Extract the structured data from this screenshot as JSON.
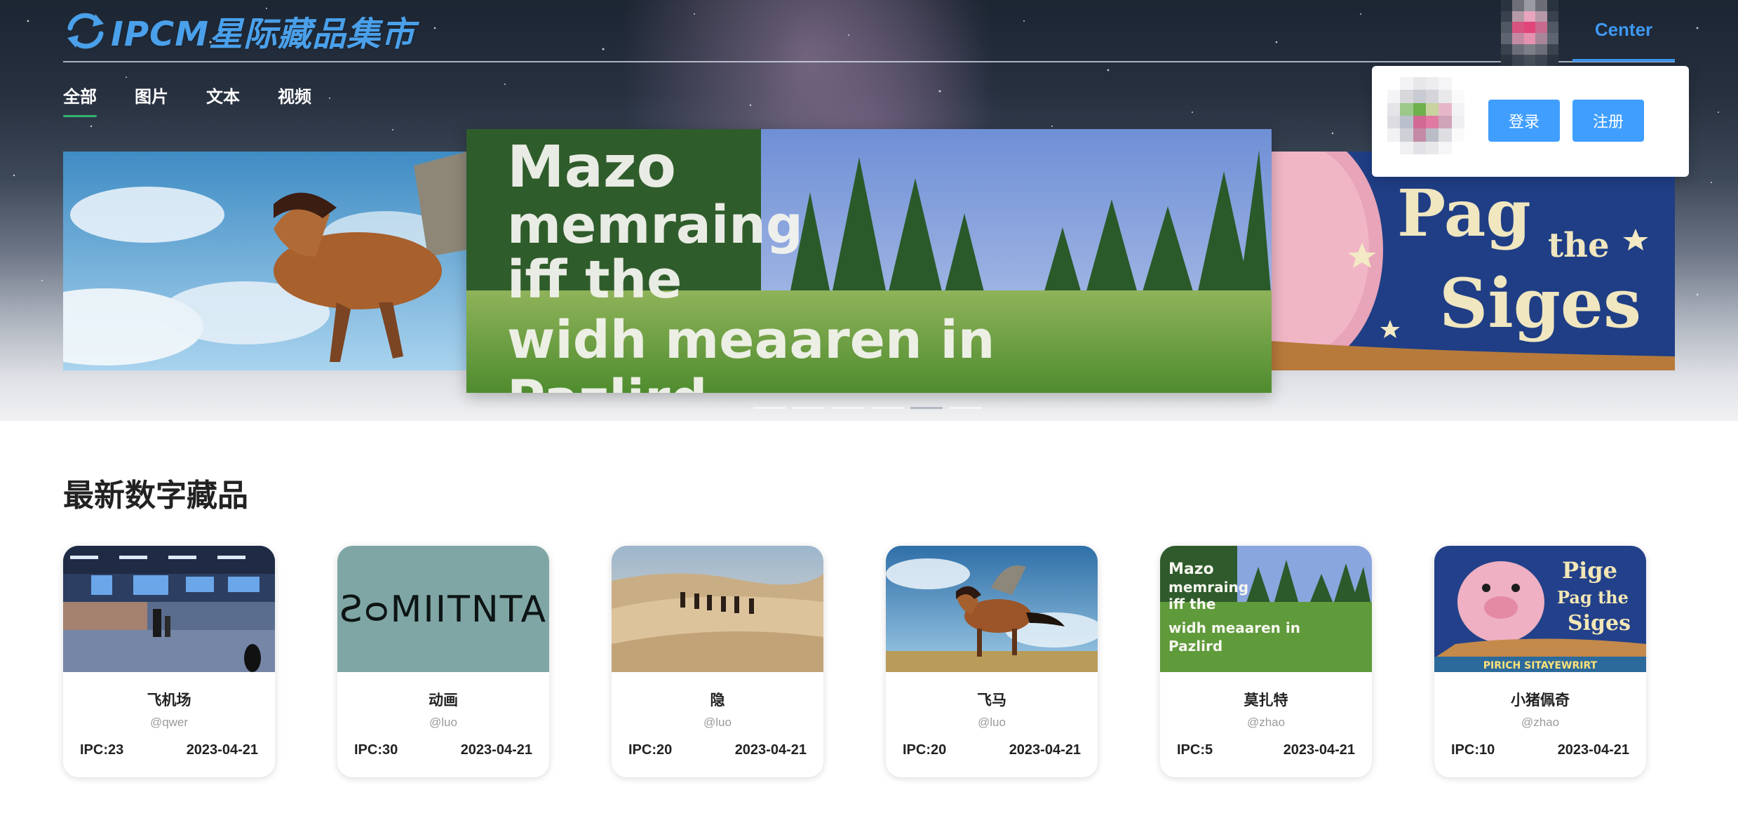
{
  "app": {
    "logo_text": "IPCM星际藏品集市",
    "center_label": "Center"
  },
  "tabs": [
    {
      "label": "全部",
      "active": true
    },
    {
      "label": "图片",
      "active": false
    },
    {
      "label": "文本",
      "active": false
    },
    {
      "label": "视频",
      "active": false
    }
  ],
  "carousel": {
    "slide_count": 6,
    "active_index": 4,
    "center_slide_text": [
      "Mazo",
      "memraing",
      "iff the",
      "widh meaaren in",
      "Pazlird"
    ],
    "right_slide_text": [
      "Pag",
      "the",
      "Siges"
    ]
  },
  "popover": {
    "login_label": "登录",
    "register_label": "注册"
  },
  "section": {
    "title": "最新数字藏品"
  },
  "cards": [
    {
      "title": "飞机场",
      "author": "@qwer",
      "ipc": "IPC:23",
      "date": "2023-04-21",
      "image": "airport"
    },
    {
      "title": "动画",
      "author": "@luo",
      "ipc": "IPC:30",
      "date": "2023-04-21",
      "image": "animation-text",
      "image_text": "ƧᴑMIITNTA"
    },
    {
      "title": "隐",
      "author": "@luo",
      "ipc": "IPC:20",
      "date": "2023-04-21",
      "image": "desert"
    },
    {
      "title": "飞马",
      "author": "@luo",
      "ipc": "IPC:20",
      "date": "2023-04-21",
      "image": "pegasus"
    },
    {
      "title": "莫扎特",
      "author": "@zhao",
      "ipc": "IPC:5",
      "date": "2023-04-21",
      "image": "meadow-text",
      "image_text": [
        "Mazo",
        "memraing",
        "iff the",
        "widh meaaren in",
        "Pazlird"
      ]
    },
    {
      "title": "小猪佩奇",
      "author": "@zhao",
      "ipc": "IPC:10",
      "date": "2023-04-21",
      "image": "pig-book",
      "image_text": [
        "Pige",
        "Pag the",
        "Siges",
        "PIRICH SITAYEWRIRT"
      ]
    }
  ],
  "colors": {
    "accent": "#409eff",
    "logo": "#4aa0ea",
    "tab_indicator": "#33b36e"
  }
}
